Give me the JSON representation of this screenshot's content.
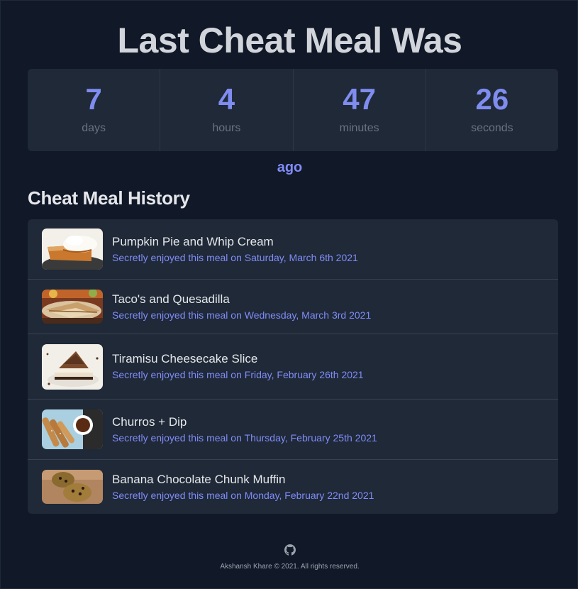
{
  "header": {
    "title": "Last Cheat Meal Was",
    "ago": "ago"
  },
  "timer": [
    {
      "value": "7",
      "label": "days"
    },
    {
      "value": "4",
      "label": "hours"
    },
    {
      "value": "47",
      "label": "minutes"
    },
    {
      "value": "26",
      "label": "seconds"
    }
  ],
  "history": {
    "title": "Cheat Meal History",
    "items": [
      {
        "name": "Pumpkin Pie and Whip Cream",
        "date": "Secretly enjoyed this meal on Saturday, March 6th 2021",
        "image": "pumpkin-pie-photo"
      },
      {
        "name": "Taco's and Quesadilla",
        "date": "Secretly enjoyed this meal on Wednesday, March 3rd 2021",
        "image": "quesadilla-photo"
      },
      {
        "name": "Tiramisu Cheesecake Slice",
        "date": "Secretly enjoyed this meal on Friday, February 26th 2021",
        "image": "cheesecake-photo"
      },
      {
        "name": "Churros + Dip",
        "date": "Secretly enjoyed this meal on Thursday, February 25th 2021",
        "image": "churros-photo"
      },
      {
        "name": "Banana Chocolate Chunk Muffin",
        "date": "Secretly enjoyed this meal on Monday, February 22nd 2021",
        "image": "muffin-photo"
      }
    ]
  },
  "footer": {
    "icon": "github-icon",
    "copyright": "Akshansh Khare © 2021. All rights reserved."
  },
  "colors": {
    "background": "#111827",
    "card": "#1f2937",
    "accent": "#818cf8"
  }
}
